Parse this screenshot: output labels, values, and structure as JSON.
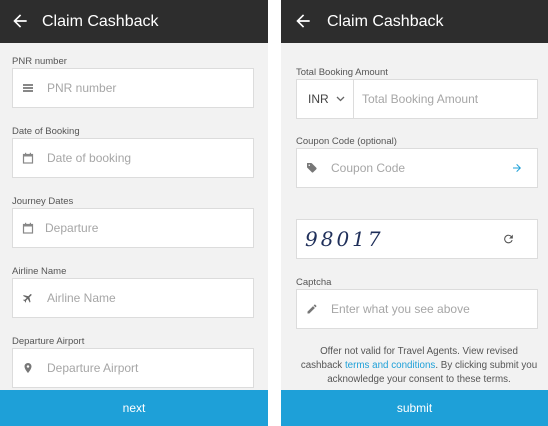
{
  "left_screen": {
    "header": {
      "title": "Claim Cashback",
      "back_icon": "arrow-left-icon"
    },
    "fields": {
      "pnr": {
        "label": "PNR number",
        "placeholder": "PNR number",
        "value": ""
      },
      "booking_date": {
        "label": "Date of Booking",
        "placeholder": "Date of booking",
        "value": ""
      },
      "journey_dates": {
        "label": "Journey Dates",
        "placeholder": "Departure",
        "value": ""
      },
      "airline": {
        "label": "Airline Name",
        "placeholder": "Airline Name",
        "value": ""
      },
      "departure_airport": {
        "label": "Departure Airport",
        "placeholder": "Departure Airport",
        "value": ""
      }
    },
    "next_label": "next"
  },
  "right_screen": {
    "header": {
      "title": "Claim Cashback",
      "back_icon": "arrow-left-icon"
    },
    "amount": {
      "label": "Total Booking Amount",
      "currency": "INR",
      "placeholder": "Total Booking Amount",
      "value": ""
    },
    "coupon": {
      "label": "Coupon Code (optional)",
      "placeholder": "Coupon Code",
      "value": ""
    },
    "captcha_image_text": "98017",
    "captcha": {
      "label": "Captcha",
      "placeholder": "Enter what you see above",
      "value": ""
    },
    "notice": {
      "before": "Offer not valid for Travel Agents. View revised cashback ",
      "link": "terms and conditions",
      "after": ". By clicking submit you acknowledge your consent to these terms."
    },
    "submit_label": "submit"
  },
  "colors": {
    "appbar": "#2d2d2d",
    "accent": "#1ea0d8",
    "background": "#f2f2f2",
    "field_border": "#dcdcdc"
  }
}
